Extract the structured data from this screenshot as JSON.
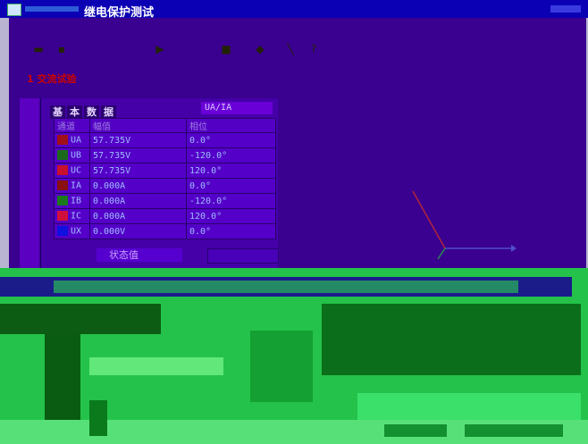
{
  "window": {
    "title": "继电保护测试"
  },
  "toolbar": {
    "items": [
      {
        "name": "open-icon",
        "glyph": "▬"
      },
      {
        "name": "save-icon",
        "glyph": "▪"
      },
      {
        "name": "run-icon",
        "glyph": "▶"
      },
      {
        "name": "stop-icon",
        "glyph": "■"
      },
      {
        "name": "chart-icon",
        "glyph": "◆"
      },
      {
        "name": "pen-icon",
        "glyph": "╲"
      },
      {
        "name": "help-icon",
        "glyph": "?"
      }
    ]
  },
  "module": {
    "title": "1 交流试验"
  },
  "panel": {
    "tabs": [
      "基",
      "本",
      "数",
      "据"
    ],
    "channel_select": "UA/IA",
    "headers": [
      "通道",
      "幅值",
      "相位"
    ],
    "rows": [
      {
        "ch": "UA",
        "amp": "57.735V",
        "phase": "0.0°",
        "color": "#a01018"
      },
      {
        "ch": "UB",
        "amp": "57.735V",
        "phase": "-120.0°",
        "color": "#1c6b1c"
      },
      {
        "ch": "UC",
        "amp": "57.735V",
        "phase": "120.0°",
        "color": "#c8102c"
      },
      {
        "ch": "IA",
        "amp": "0.000A",
        "phase": "0.0°",
        "color": "#8a1010"
      },
      {
        "ch": "IB",
        "amp": "0.000A",
        "phase": "-120.0°",
        "color": "#1c7a1c"
      },
      {
        "ch": "IC",
        "amp": "0.000A",
        "phase": "120.0°",
        "color": "#d0103c"
      },
      {
        "ch": "UX",
        "amp": "0.000V",
        "phase": "0.0°",
        "color": "#1010e0"
      }
    ],
    "set_button": "状态值"
  },
  "colors": {
    "title_bar": "#0b00b4",
    "app_background": "#3a0090",
    "corruption_green": "#2bd64f"
  }
}
